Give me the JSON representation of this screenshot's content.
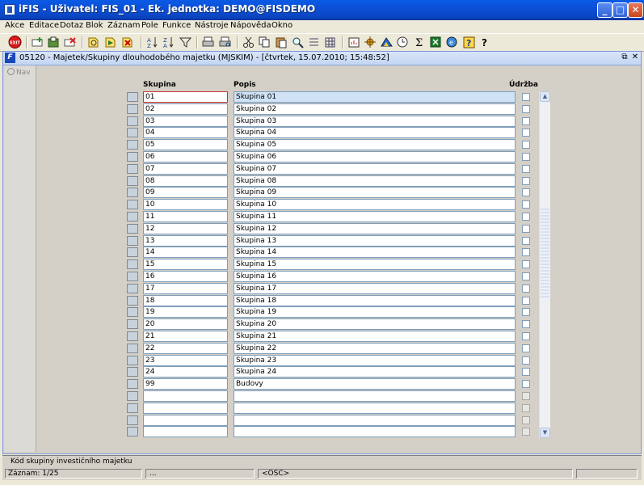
{
  "window": {
    "title": "iFIS - Uživatel: FIS_01 - Ek. jednotka: DEMO@FISDEMO",
    "minimize_glyph": "_",
    "maximize_glyph": "□",
    "close_glyph": "✕"
  },
  "menu": [
    "Akce",
    "Editace",
    "Dotaz",
    "Blok",
    "Záznam",
    "Pole",
    "Funkce",
    "Nástroje",
    "Nápověda",
    "Okno"
  ],
  "toolbar": {
    "exit_label": "EXIT",
    "icons": [
      "exit-icon",
      "add-record-icon",
      "save-icon",
      "delete-record-icon",
      "query-icon",
      "query-run-icon",
      "query-cancel-icon",
      "sort-asc-icon",
      "sort-desc-icon",
      "filter-icon",
      "print-icon",
      "print-preview-icon",
      "cut-icon",
      "copy-icon",
      "paste-icon",
      "find-icon",
      "list-icon",
      "grid-icon",
      "report-icon",
      "tools-icon",
      "chart-icon",
      "calendar-icon",
      "sum-icon",
      "excel-icon",
      "export-icon",
      "help-icon",
      "context-help-icon"
    ]
  },
  "form": {
    "title": "05120 - Majetek/Skupiny dlouhodobého majetku (MJSKIM) - [čtvrtek, 15.07.2010; 15:48:52]",
    "icon_letter": "F",
    "restore_glyph": "⧉",
    "close_glyph": "✕",
    "nav_label": "Nav"
  },
  "columns": {
    "skupina": "Skupina",
    "popis": "Popis",
    "udrzba": "Údržba"
  },
  "rows": [
    {
      "skupina": "01",
      "popis": "Skupina 01"
    },
    {
      "skupina": "02",
      "popis": "Skupina 02"
    },
    {
      "skupina": "03",
      "popis": "Skupina 03"
    },
    {
      "skupina": "04",
      "popis": "Skupina 04"
    },
    {
      "skupina": "05",
      "popis": "Skupina 05"
    },
    {
      "skupina": "06",
      "popis": "Skupina 06"
    },
    {
      "skupina": "07",
      "popis": "Skupina 07"
    },
    {
      "skupina": "08",
      "popis": "Skupina 08"
    },
    {
      "skupina": "09",
      "popis": "Skupina 09"
    },
    {
      "skupina": "10",
      "popis": "Skupina 10"
    },
    {
      "skupina": "11",
      "popis": "Skupina 11"
    },
    {
      "skupina": "12",
      "popis": "Skupina 12"
    },
    {
      "skupina": "13",
      "popis": "Skupina 13"
    },
    {
      "skupina": "14",
      "popis": "Skupina 14"
    },
    {
      "skupina": "15",
      "popis": "Skupina 15"
    },
    {
      "skupina": "16",
      "popis": "Skupina 16"
    },
    {
      "skupina": "17",
      "popis": "Skupina 17"
    },
    {
      "skupina": "18",
      "popis": "Skupina 18"
    },
    {
      "skupina": "19",
      "popis": "Skupina 19"
    },
    {
      "skupina": "20",
      "popis": "Skupina 20"
    },
    {
      "skupina": "21",
      "popis": "Skupina 21"
    },
    {
      "skupina": "22",
      "popis": "Skupina 22"
    },
    {
      "skupina": "23",
      "popis": "Skupina 23"
    },
    {
      "skupina": "24",
      "popis": "Skupina 24"
    },
    {
      "skupina": "99",
      "popis": "Budovy"
    },
    {
      "skupina": "",
      "popis": ""
    },
    {
      "skupina": "",
      "popis": ""
    },
    {
      "skupina": "",
      "popis": ""
    },
    {
      "skupina": "",
      "popis": ""
    }
  ],
  "status": {
    "hint": "Kód skupiny investičního majetku",
    "record": "Záznam: 1/25",
    "ellipsis": "...",
    "mode": "<OSC>"
  },
  "colors": {
    "titlebar": "#0b52dc",
    "active_field": "#cfe2f6",
    "active_border": "#cc3333",
    "panel": "#d4d0c8"
  }
}
